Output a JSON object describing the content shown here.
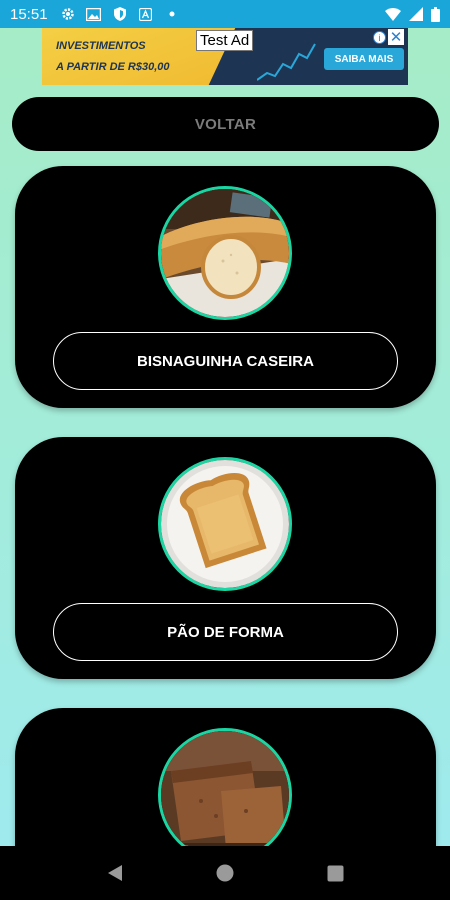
{
  "status_bar": {
    "time": "15:51",
    "background": "#1aa6d9",
    "icons_left": [
      "gear-icon",
      "image-icon",
      "shield-icon",
      "a-badge-icon",
      "dot-icon"
    ],
    "icons_right": [
      "wifi-icon",
      "signal-icon",
      "battery-icon"
    ]
  },
  "ad": {
    "line1": "INVESTIMENTOS",
    "line2": "A PARTIR DE R$30,00",
    "test_label": "Test Ad",
    "cta": "SAIBA MAIS",
    "info_glyph": "i",
    "close_glyph": "✕"
  },
  "back_button": {
    "label": "VOLTAR"
  },
  "recipes": [
    {
      "label": "BISNAGUINHA CASEIRA",
      "icon": "bread-loaf-photo"
    },
    {
      "label": "PÃO DE FORMA",
      "icon": "toast-slice-photo"
    },
    {
      "label": "",
      "icon": "pound-cake-photo"
    }
  ],
  "colors": {
    "accent_ring": "#1bd6a2",
    "card": "#000000",
    "back_label": "#7b7b7b"
  },
  "nav_bar": {
    "icons": [
      "back-triangle-icon",
      "home-circle-icon",
      "recents-square-icon"
    ]
  }
}
